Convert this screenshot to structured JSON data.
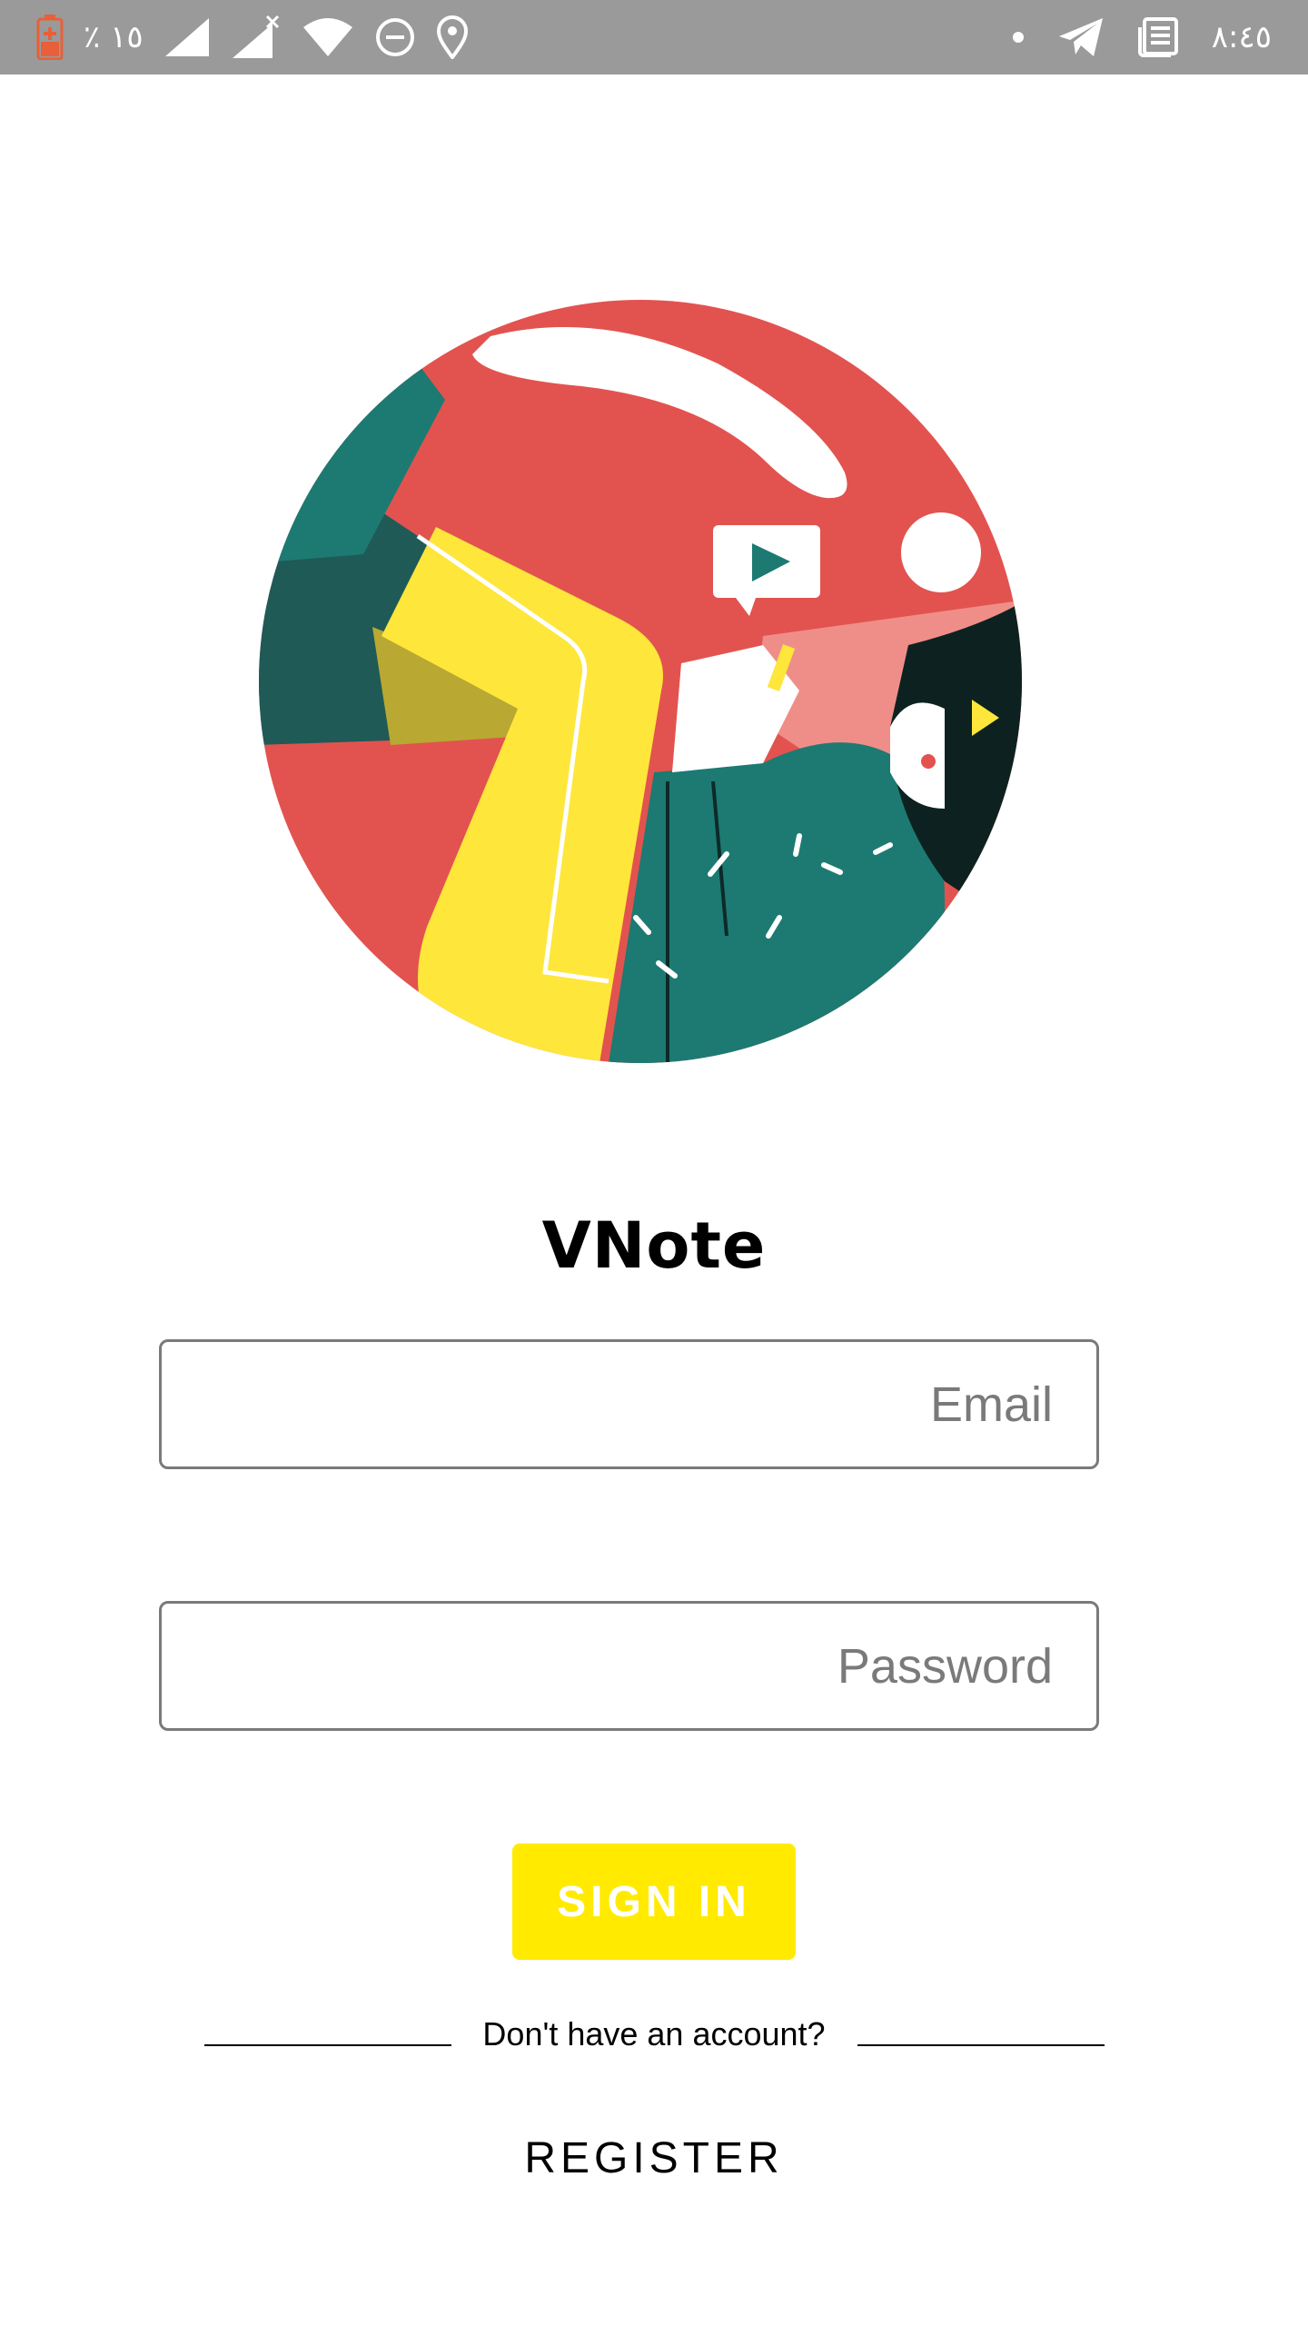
{
  "status_bar": {
    "battery_percent": "٪ ١٥",
    "time": "٨:٤٥"
  },
  "app": {
    "title": "VNote"
  },
  "login_form": {
    "email_placeholder": "Email",
    "password_placeholder": "Password",
    "signin_label": "SIGN IN",
    "divider_text": "Don't have an account?",
    "register_label": "REGISTER"
  }
}
